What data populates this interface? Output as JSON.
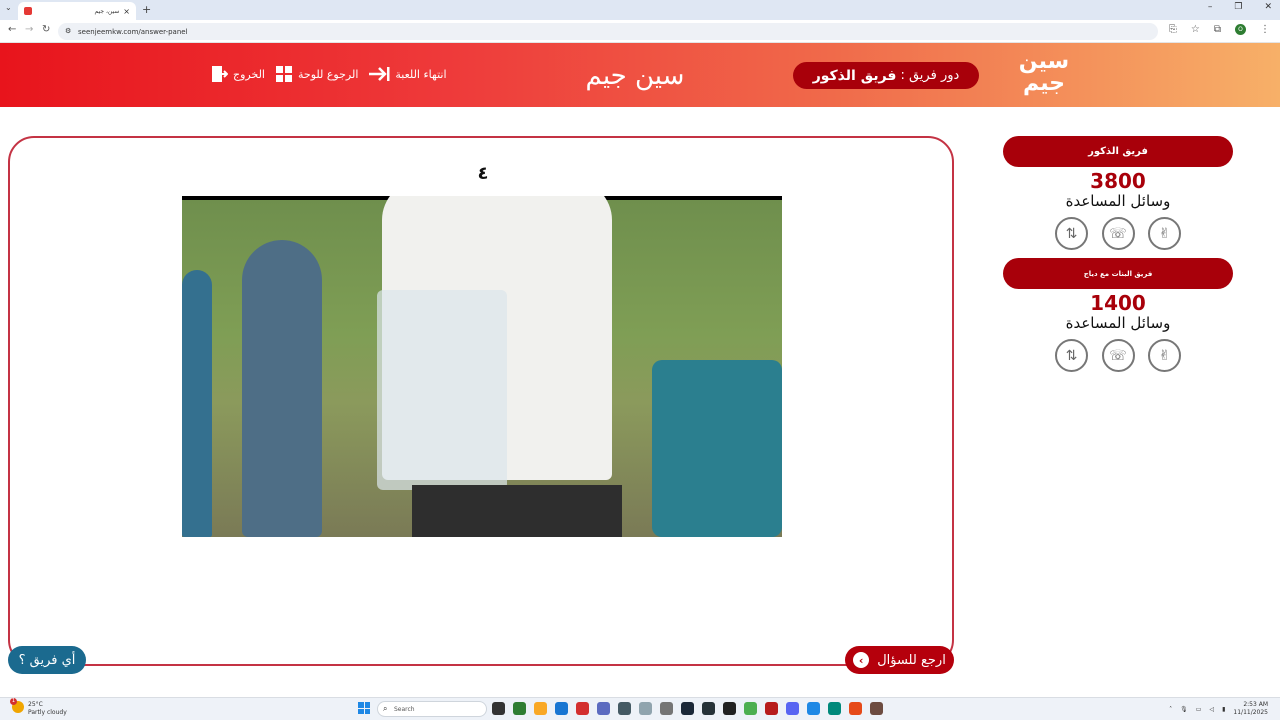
{
  "browser": {
    "tab_title": "سين، جيم",
    "url": "seenjeemkw.com/answer-panel",
    "profile_initial": "O"
  },
  "header": {
    "logo_line1": "سين",
    "logo_line2": "جيم",
    "turn_label": "دور فريق :",
    "turn_team": "فريق الذكور",
    "brand": "سين جيم",
    "actions": {
      "end_game": "انتهاء اللعبة",
      "back_to_board": "الرجوع للوحة",
      "exit": "الخروج"
    }
  },
  "main": {
    "question_number": "٤",
    "media_icon": "video-frame",
    "back_button": "ارجع للسؤال",
    "which_team_button": "أي فريق ؟"
  },
  "sidebar": {
    "teams": [
      {
        "name": "فريق الذكور",
        "score": "3800",
        "help_title": "وسائل المساعدة",
        "lifelines": [
          "two-answers-icon",
          "call-friend-icon",
          "hand-icon"
        ]
      },
      {
        "name": "فريق البنات مع دياج",
        "score": "1400",
        "help_title": "وسائل المساعدة",
        "lifelines": [
          "two-answers-icon",
          "call-friend-icon",
          "hand-icon"
        ]
      }
    ]
  },
  "taskbar": {
    "temperature": "25°C",
    "weather": "Partly cloudy",
    "search_placeholder": "Search",
    "time": "2:53 AM",
    "date": "11/11/2025"
  },
  "colors": {
    "brand_red": "#a8000a",
    "header_start": "#e8141c",
    "header_end": "#f7b068",
    "card_border": "#c43344",
    "which_team_blue": "#1b6a8f"
  }
}
